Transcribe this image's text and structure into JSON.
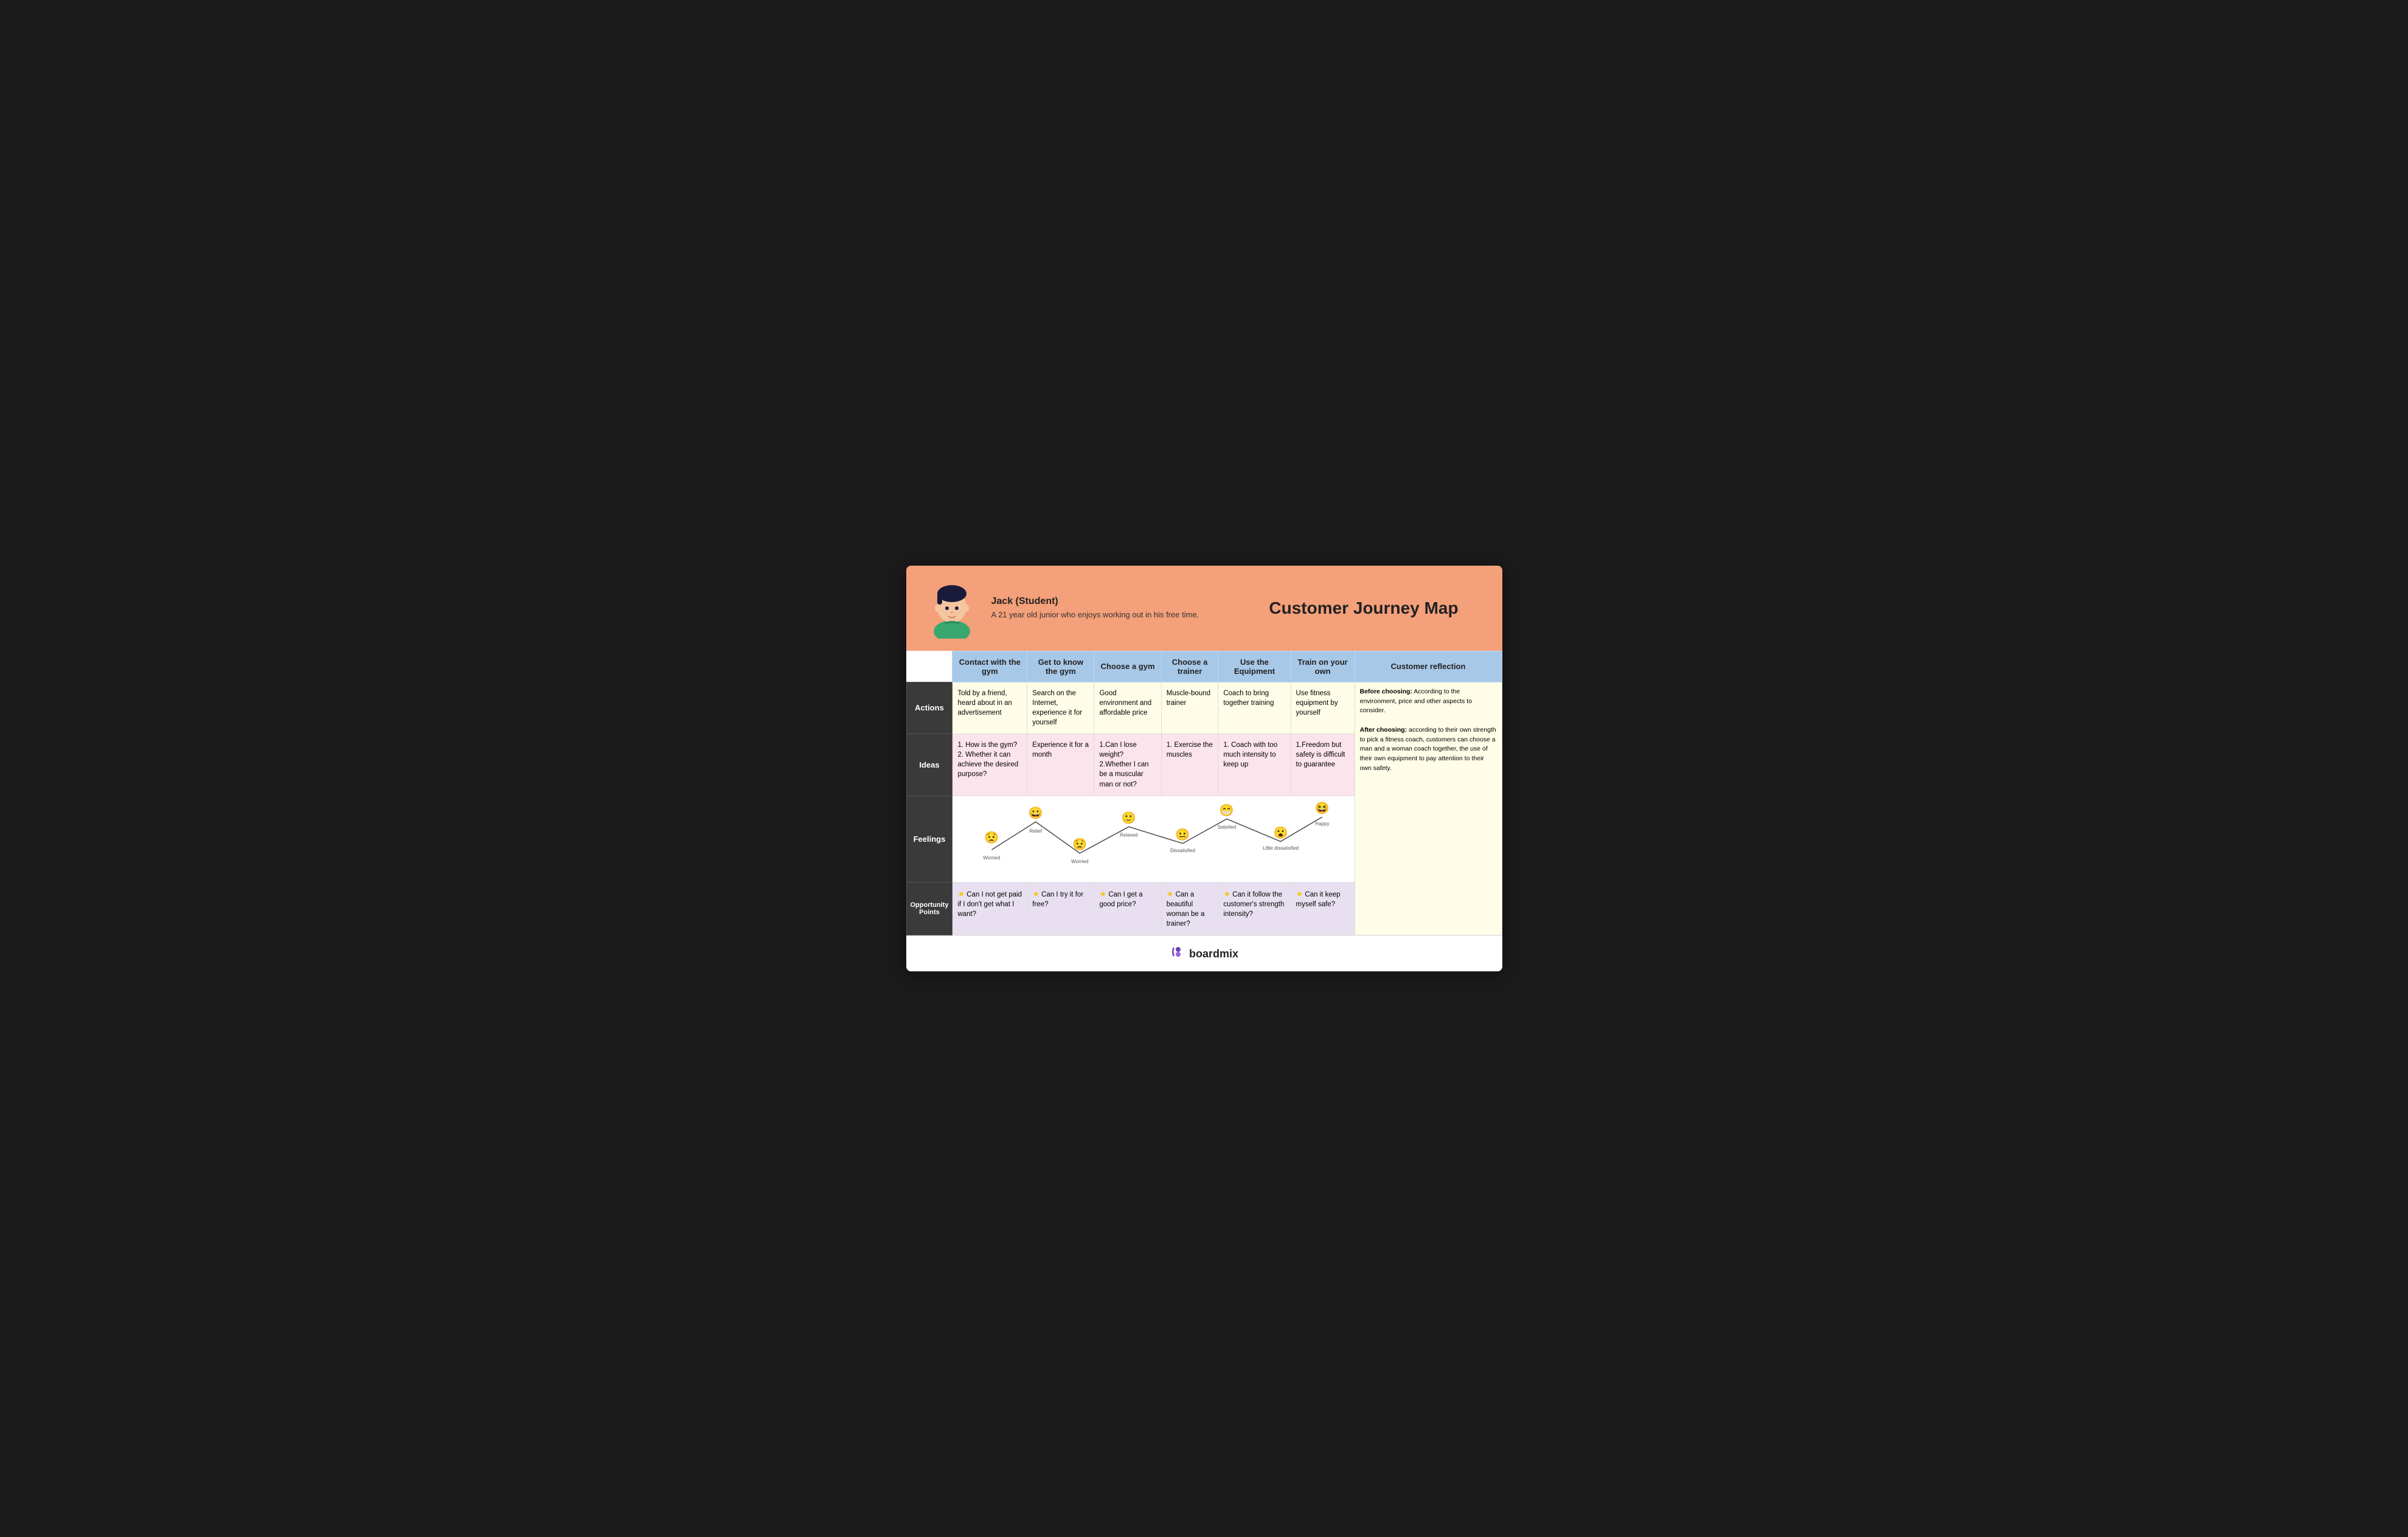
{
  "header": {
    "persona_name": "Jack (Student)",
    "persona_desc": "A 21 year old junior who enjoys working out in his free time.",
    "map_title": "Customer Journey Map"
  },
  "columns": [
    {
      "id": "contact",
      "label": "Contact with the gym"
    },
    {
      "id": "know",
      "label": "Get to know the gym"
    },
    {
      "id": "choose_gym",
      "label": "Choose a gym"
    },
    {
      "id": "choose_trainer",
      "label": "Choose a trainer"
    },
    {
      "id": "equipment",
      "label": "Use the Equipment"
    },
    {
      "id": "train",
      "label": "Train on your own"
    },
    {
      "id": "reflection",
      "label": "Customer reflection"
    }
  ],
  "rows": {
    "actions": {
      "label": "Actions",
      "cells": [
        "Told by a friend, heard about in an advertisement",
        "Search on the Internet, experience it for yourself",
        "Good environment and affordable price",
        "Muscle-bound trainer",
        "Coach to bring together training",
        "Use fitness equipment by yourself",
        "Before choosing: According to the environment, price and other aspects to consider.\n\nAfter choosing: according to their own strength to pick a fitness coach, customers can choose a man and a woman coach together, the use of their own equipment to pay attention to their own safety."
      ]
    },
    "ideas": {
      "label": "Ideas",
      "cells": [
        "1. How is the gym?\n2. Whether it can achieve the desired purpose?",
        "Experience it for a month",
        "1.Can I lose weight?\n2.Whether I can be a muscular man or not?",
        "1. Exercise the muscles",
        "1. Coach with too much intensity to keep up",
        "1.Freedom but safety is difficult to guarantee",
        ""
      ]
    },
    "feelings": {
      "label": "Feelings",
      "emojis": [
        {
          "label": "Worried",
          "type": "worried",
          "y": 75
        },
        {
          "label": "Relief",
          "type": "happy",
          "y": 25
        },
        {
          "label": "Worried",
          "type": "worried2",
          "y": 85
        },
        {
          "label": "Relaxed",
          "type": "relaxed",
          "y": 35
        },
        {
          "label": "Dissatisfied",
          "type": "dissatisfied",
          "y": 70
        },
        {
          "label": "Satisfied",
          "type": "satisfied",
          "y": 20
        },
        {
          "label": "Little dissatisfied",
          "type": "little_dis",
          "y": 65
        },
        {
          "label": "Happy",
          "type": "happy2",
          "y": 15
        }
      ]
    },
    "opportunity": {
      "label": "Opportunity Points",
      "cells": [
        "Can I not get paid if I don't get what I want?",
        "Can I try it for free?",
        "Can I get a good price?",
        "Can a beautiful woman be a trainer?",
        "Can it follow the customer's strength intensity?",
        "Can it keep myself safe?",
        ""
      ]
    }
  },
  "footer": {
    "brand": "boardmix"
  }
}
